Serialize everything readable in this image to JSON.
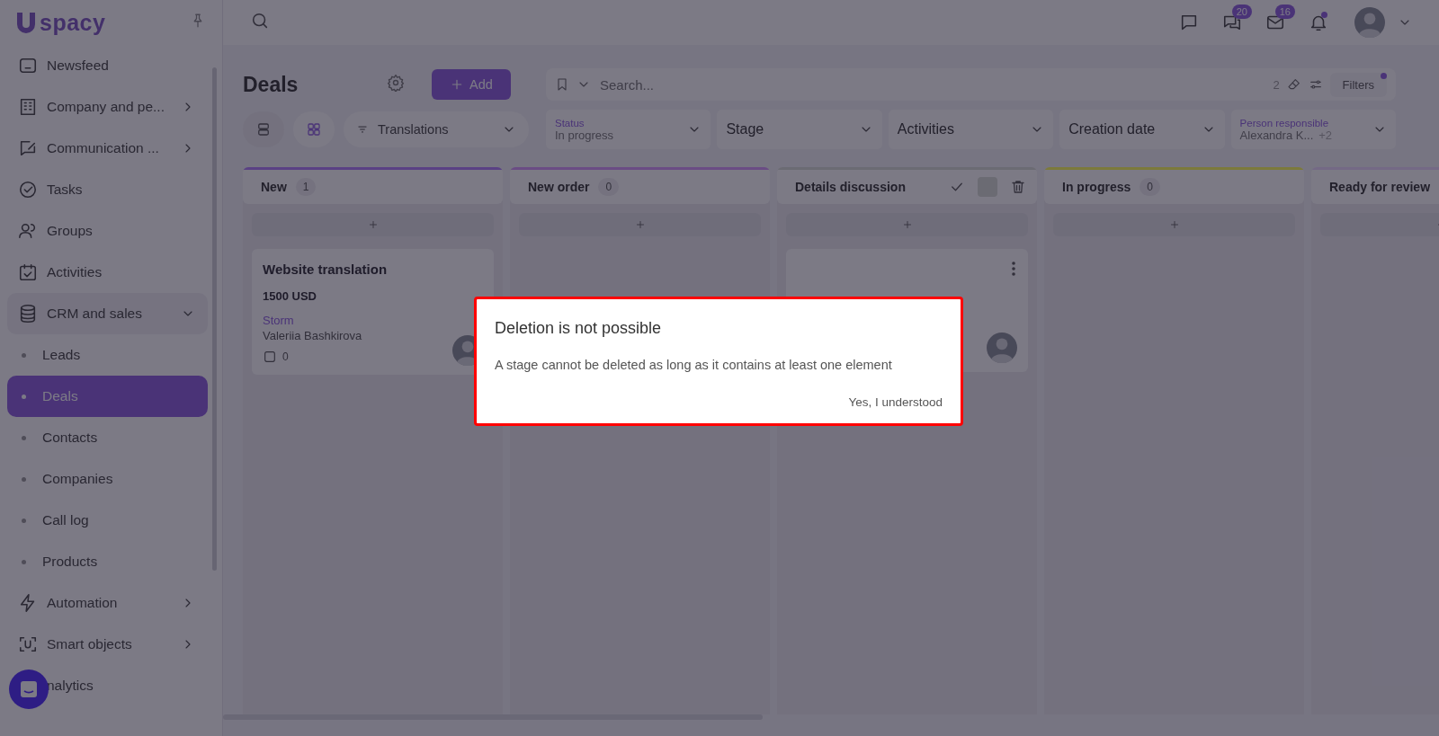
{
  "logo": {
    "text": "spacy"
  },
  "sidebar": {
    "items": [
      {
        "label": "Newsfeed"
      },
      {
        "label": "Company and pe...",
        "expanded": false
      },
      {
        "label": "Communication ...",
        "expanded": false
      },
      {
        "label": "Tasks"
      },
      {
        "label": "Groups"
      },
      {
        "label": "Activities"
      },
      {
        "label": "CRM and sales",
        "expanded": true,
        "children": [
          {
            "label": "Leads",
            "selected": false
          },
          {
            "label": "Deals",
            "selected": true
          },
          {
            "label": "Contacts",
            "selected": false
          },
          {
            "label": "Companies",
            "selected": false
          },
          {
            "label": "Call log",
            "selected": false
          },
          {
            "label": "Products",
            "selected": false
          }
        ]
      },
      {
        "label": "Automation",
        "expanded": false
      },
      {
        "label": "Smart objects",
        "expanded": false
      },
      {
        "label": "nalytics"
      }
    ]
  },
  "topbar": {
    "icons": [
      {
        "kind": "chat"
      },
      {
        "kind": "messages",
        "badge": "20"
      },
      {
        "kind": "mail",
        "badge": "16"
      },
      {
        "kind": "bell",
        "dot": true
      }
    ]
  },
  "header": {
    "title": "Deals",
    "add_button": "Add",
    "search": {
      "placeholder": "Search...",
      "count": "2",
      "filters": "Filters",
      "dot": true
    }
  },
  "views": [
    {
      "kind": "list",
      "selected": false
    },
    {
      "kind": "board",
      "selected": true
    }
  ],
  "pipeline": "Translations",
  "filters": [
    {
      "label": "Status",
      "value": "In progress"
    },
    {
      "placeholder": "Stage"
    },
    {
      "placeholder": "Activities"
    },
    {
      "placeholder": "Creation date"
    },
    {
      "label": "Person responsible",
      "value": "Alexandra K...",
      "extra": "+2"
    }
  ],
  "columns": [
    {
      "name": "New",
      "count": "1",
      "color": "#5a4184",
      "kind": "normal",
      "cards": [
        {
          "kind": "card",
          "title": "Website translation",
          "amount": "1500 USD",
          "company": "Storm",
          "person": "Valeriia Bashkirova",
          "tasks": "0"
        }
      ]
    },
    {
      "name": "New order",
      "count": "0",
      "color": "#6a4c84",
      "kind": "normal"
    },
    {
      "name": "Details discussion",
      "color": "#6c6b73",
      "kind": "editing",
      "cards": [
        {
          "kind": "card"
        }
      ]
    },
    {
      "name": "In progress",
      "count": "0",
      "color": "#8a7a3c",
      "kind": "normal"
    },
    {
      "name": "Ready for review",
      "color": "#746985",
      "kind": "normal"
    }
  ],
  "dialog": {
    "title": "Deletion is not possible",
    "message": "A stage cannot be deleted as long as it contains at least one element",
    "button": "Yes, I understood"
  }
}
